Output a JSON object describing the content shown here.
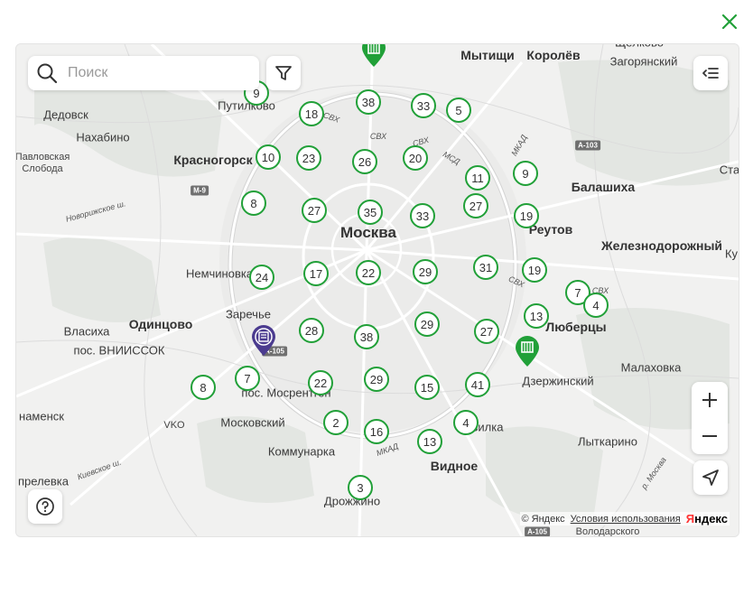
{
  "modal": {
    "close_icon": "close-icon"
  },
  "search": {
    "placeholder": "Поиск",
    "icon": "search-icon"
  },
  "controls": {
    "filter_icon": "filter-icon",
    "list_icon": "list-collapse-icon",
    "zoom_in_label": "+",
    "zoom_out_label": "−",
    "geolocate_icon": "navigation-arrow-icon",
    "help_label": "?"
  },
  "copyright": {
    "text": "© Яндекс",
    "terms": "Условия использования",
    "logo_red": "Я",
    "logo_black": "ндекс"
  },
  "colors": {
    "accent": "#21a038",
    "pin_purple": "#4b3b8f",
    "map_bg": "#f1f1f0"
  },
  "places": [
    {
      "name": "Мытищи",
      "cls": "city"
    },
    {
      "name": "Королёв",
      "cls": "city"
    },
    {
      "name": "Щёлково",
      "cls": ""
    },
    {
      "name": "Загорянский",
      "cls": ""
    },
    {
      "name": "Путилково",
      "cls": ""
    },
    {
      "name": "Дедовск",
      "cls": ""
    },
    {
      "name": "Нахабино",
      "cls": ""
    },
    {
      "name": "Павловская",
      "cls": "small"
    },
    {
      "name": "Слобода",
      "cls": "small"
    },
    {
      "name": "Красногорск",
      "cls": "city"
    },
    {
      "name": "Балашиха",
      "cls": "city"
    },
    {
      "name": "Ста",
      "cls": ""
    },
    {
      "name": "Москва",
      "cls": "capital"
    },
    {
      "name": "Реутов",
      "cls": "city"
    },
    {
      "name": "Железнодорожный",
      "cls": "city"
    },
    {
      "name": "Ку",
      "cls": ""
    },
    {
      "name": "Немчиновка",
      "cls": ""
    },
    {
      "name": "Заречье",
      "cls": ""
    },
    {
      "name": "Власиха",
      "cls": ""
    },
    {
      "name": "Одинцово",
      "cls": "city"
    },
    {
      "name": "пос. ВНИИССОК",
      "cls": ""
    },
    {
      "name": "Люберцы",
      "cls": "city"
    },
    {
      "name": "Малаховка",
      "cls": ""
    },
    {
      "name": "Дзержинский",
      "cls": ""
    },
    {
      "name": "пос. Мосрентген",
      "cls": ""
    },
    {
      "name": "наменск",
      "cls": ""
    },
    {
      "name": "VKO",
      "cls": "small"
    },
    {
      "name": "Московский",
      "cls": ""
    },
    {
      "name": "Коммунарка",
      "cls": ""
    },
    {
      "name": "Видное",
      "cls": "city"
    },
    {
      "name": "вилка",
      "cls": ""
    },
    {
      "name": "Лыткарино",
      "cls": ""
    },
    {
      "name": "Дрожжино",
      "cls": ""
    },
    {
      "name": "прелевка",
      "cls": ""
    },
    {
      "name": "Володарского",
      "cls": "small"
    }
  ],
  "roads": [
    {
      "name": "СВХ",
      "cls": "road"
    },
    {
      "name": "СВХ",
      "cls": "road"
    },
    {
      "name": "СВХ",
      "cls": "road"
    },
    {
      "name": "МСД",
      "cls": "road"
    },
    {
      "name": "МКАД",
      "cls": "road"
    },
    {
      "name": "МКАД",
      "cls": "road"
    },
    {
      "name": "СВХ",
      "cls": "road"
    },
    {
      "name": "СВХ",
      "cls": "road"
    },
    {
      "name": "Новорижское ш.",
      "cls": "road"
    },
    {
      "name": "Киевское ш.",
      "cls": "road"
    },
    {
      "name": "р. Москва",
      "cls": "road"
    },
    {
      "name": "М-9",
      "cls": "road-sign"
    },
    {
      "name": "А-103",
      "cls": "road-sign"
    },
    {
      "name": "А-105",
      "cls": "road-sign"
    },
    {
      "name": "А-105",
      "cls": "road-sign"
    }
  ],
  "clusters": [
    "9",
    "18",
    "38",
    "33",
    "5",
    "10",
    "23",
    "26",
    "20",
    "11",
    "9",
    "8",
    "27",
    "35",
    "33",
    "27",
    "19",
    "24",
    "17",
    "22",
    "29",
    "31",
    "19",
    "7",
    "4",
    "13",
    "28",
    "38",
    "29",
    "27",
    "7",
    "8",
    "22",
    "29",
    "15",
    "41",
    "2",
    "16",
    "4",
    "13",
    "3"
  ],
  "pins": [
    {
      "type": "office",
      "icon": "building-pin-icon"
    },
    {
      "type": "office",
      "icon": "building-pin-icon"
    },
    {
      "type": "selected",
      "icon": "document-pin-icon"
    }
  ]
}
